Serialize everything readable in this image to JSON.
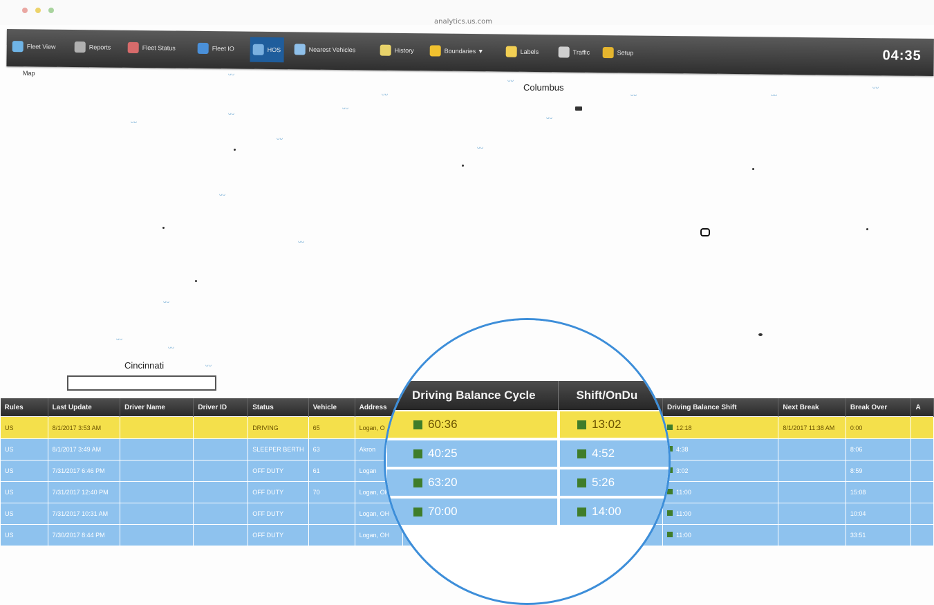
{
  "browser": {
    "url": "analytics.us.com"
  },
  "toolbar": {
    "items": [
      {
        "label": "Fleet View",
        "icon": "fleet-view-icon",
        "color": "#6fb4e6"
      },
      {
        "label": "Reports",
        "icon": "reports-icon",
        "color": "#b0b0b0"
      },
      {
        "label": "Fleet Status",
        "icon": "fleet-status-icon",
        "color": "#d76b6b"
      },
      {
        "label": "Fleet IO",
        "icon": "fleet-io-icon",
        "color": "#4a90d9"
      },
      {
        "label": "HOS",
        "icon": "hos-icon",
        "color": "#7ab0e0"
      },
      {
        "label": "Nearest Vehicles",
        "icon": "nearest-vehicles-icon",
        "color": "#8fc0ea"
      },
      {
        "label": "History",
        "icon": "history-icon",
        "color": "#e7d26a"
      },
      {
        "label": "Boundaries ▼",
        "icon": "boundaries-icon",
        "color": "#f0c12f"
      },
      {
        "label": "Labels",
        "icon": "labels-icon",
        "color": "#f2cf53"
      },
      {
        "label": "Traffic",
        "icon": "traffic-icon",
        "color": "#cfcfcf"
      },
      {
        "label": "Setup",
        "icon": "setup-icon",
        "color": "#e5b52e"
      }
    ],
    "active_index": 4,
    "clock": "04:35"
  },
  "map": {
    "tab_label": "Map",
    "cities": [
      "Columbus",
      "Cincinnati"
    ]
  },
  "table": {
    "columns": [
      "Rules",
      "Last Update",
      "Driver Name",
      "Driver ID",
      "Status",
      "Vehicle",
      "Address",
      "Driving Balance Cycle",
      "Shift/OnDuty",
      "Driving Balance Shift",
      "Next Break",
      "Break Over",
      "A"
    ],
    "rows": [
      {
        "cells": [
          "US",
          "8/1/2017 3:53 AM",
          "",
          "",
          "DRIVING",
          "65",
          "Logan, O",
          "60:36",
          "13:02",
          "12:18",
          "8/1/2017 11:38 AM",
          "0:00",
          ""
        ],
        "highlight": true
      },
      {
        "cells": [
          "US",
          "8/1/2017 3:49 AM",
          "",
          "",
          "SLEEPER BERTH",
          "63",
          "Akron",
          "40:25",
          "4:52",
          "4:38",
          "",
          "8:06",
          ""
        ]
      },
      {
        "cells": [
          "US",
          "7/31/2017 6:46 PM",
          "",
          "",
          "OFF DUTY",
          "61",
          "Logan",
          "63:20",
          "5:26",
          "3:02",
          "",
          "8:59",
          ""
        ]
      },
      {
        "cells": [
          "US",
          "7/31/2017 12:40 PM",
          "",
          "",
          "OFF DUTY",
          "70",
          "Logan, OH",
          "",
          "",
          "11:00",
          "",
          "15:08",
          ""
        ]
      },
      {
        "cells": [
          "US",
          "7/31/2017 10:31 AM",
          "",
          "",
          "OFF DUTY",
          "",
          "Logan, OH",
          "70:00",
          "14:00",
          "11:00",
          "",
          "10:04",
          ""
        ]
      },
      {
        "cells": [
          "US",
          "7/30/2017 8:44 PM",
          "",
          "",
          "OFF DUTY",
          "",
          "Logan, OH",
          "",
          "",
          "11:00",
          "",
          "33:51",
          ""
        ]
      }
    ]
  },
  "magnifier": {
    "headers": [
      "Driving Balance Cycle",
      "Shift/OnDu"
    ],
    "rows": [
      {
        "cycle": "60:36",
        "shift": "13:02",
        "highlight": true
      },
      {
        "cycle": "40:25",
        "shift": "4:52"
      },
      {
        "cycle": "63:20",
        "shift": "5:26"
      },
      {
        "cycle": "70:00",
        "shift": "14:00"
      }
    ]
  },
  "colors": {
    "highlight_row": "#f4e04b",
    "row": "#8ec2ee",
    "active_tab": "#1f5d9c",
    "status_square": "#3f7d2a"
  }
}
